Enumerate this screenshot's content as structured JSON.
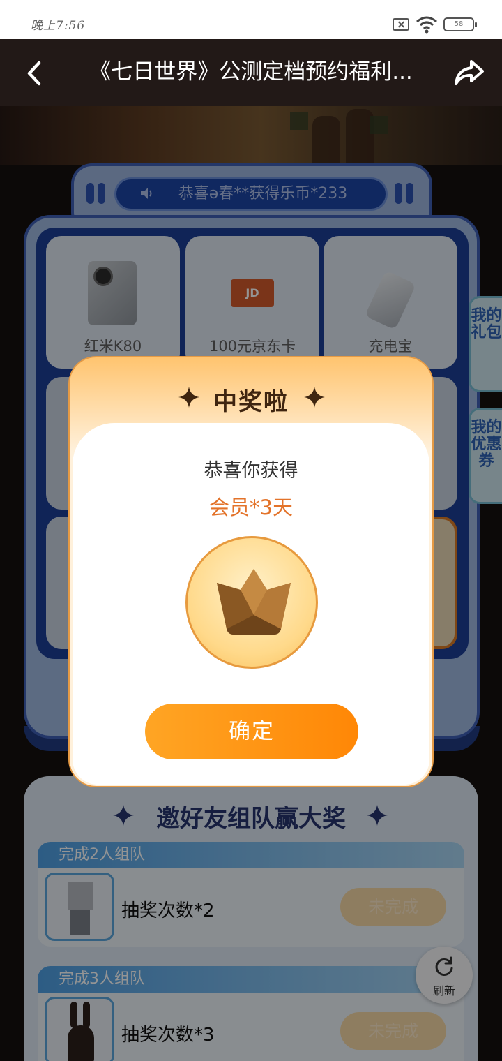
{
  "status_bar": {
    "time": "晚上7:56",
    "battery": "58"
  },
  "header": {
    "title": "《七日世界》公测定档预约福利..."
  },
  "lottery": {
    "broadcast": "恭喜ə春**获得乐币*233",
    "prizes": [
      {
        "label": "红米K80",
        "image": "phone-image"
      },
      {
        "label": "100元京东卡",
        "image": "jd-card-image"
      },
      {
        "label": "充电宝",
        "image": "power-bank-image"
      }
    ]
  },
  "side_tabs": [
    "我的礼包",
    "我的优惠券"
  ],
  "team": {
    "title": "邀好友组队赢大奖",
    "tasks": [
      {
        "header": "完成2人组队",
        "reward": "抽奖次数*2",
        "status": "未完成"
      },
      {
        "header": "完成3人组队",
        "reward": "抽奖次数*3",
        "status": "未完成"
      }
    ]
  },
  "refresh": {
    "label": "刷新"
  },
  "modal": {
    "title": "中奖啦",
    "subtitle": "恭喜你获得",
    "prize": "会员*3天",
    "confirm": "确定"
  },
  "colors": {
    "accent": "#ff8f15",
    "panel_blue": "#3f60b6",
    "prize_orange": "#e3732a"
  },
  "icons": [
    "back-arrow-icon",
    "share-icon",
    "speaker-icon",
    "crown-icon",
    "refresh-icon",
    "sparkle-icon",
    "wifi-icon",
    "battery-icon"
  ]
}
